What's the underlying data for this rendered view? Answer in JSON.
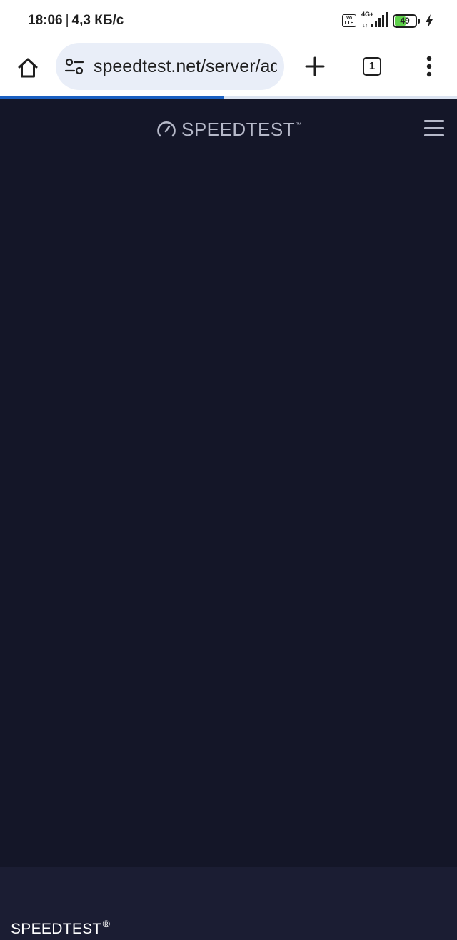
{
  "status_bar": {
    "time": "18:06",
    "separator": "|",
    "network_speed": "4,3 КБ/с",
    "volte_label": "Vo\nLTE",
    "network_type": "4G+",
    "battery_level": "49",
    "battery_fraction": 0.49,
    "icons": [
      "volte-icon",
      "signal-icon",
      "battery-icon",
      "charging-icon"
    ]
  },
  "browser": {
    "url": "speedtest.net/server/add",
    "tab_count": "1",
    "load_progress": 0.49,
    "icons": [
      "home-icon",
      "tune-icon",
      "plus-icon",
      "tab-switcher-icon",
      "more-vert-icon"
    ]
  },
  "site": {
    "logo_text": "SPEEDTEST",
    "logo_tm": "™",
    "footer_brand": "SPEEDTEST",
    "footer_reg": "®",
    "colors": {
      "background": "#141628",
      "footer_background": "#1b1d33",
      "logo": "#b6b9c9",
      "progress": "#1a5fc1"
    }
  }
}
